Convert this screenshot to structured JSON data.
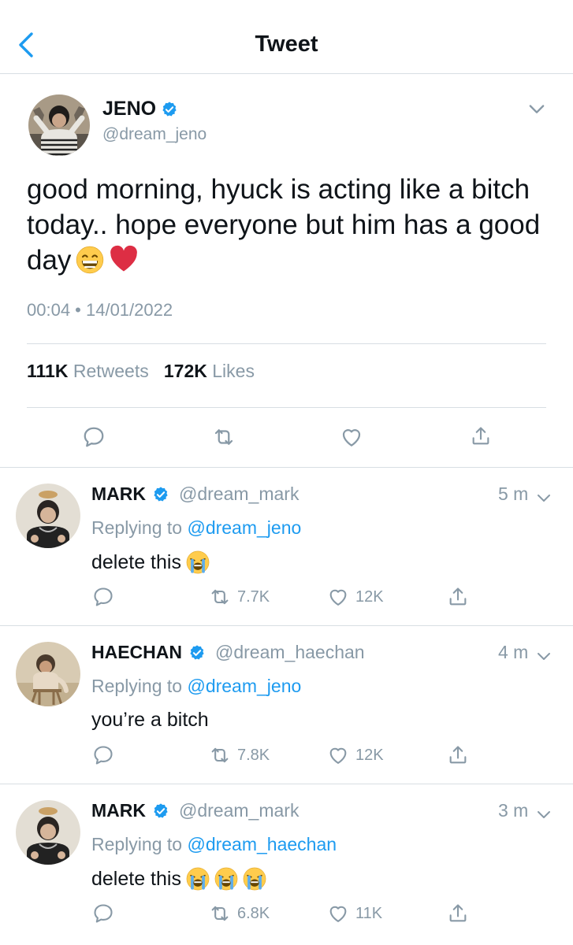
{
  "header": {
    "title": "Tweet",
    "back_icon": "chevron-left-icon"
  },
  "colors": {
    "accent": "#1d9bf0",
    "verified": "#1d9bf0",
    "muted": "#8899a6",
    "text": "#0f1419",
    "heart": "#e0245e"
  },
  "tweet": {
    "name": "JENO",
    "handle": "@dream_jeno",
    "text": "good morning, hyuck is acting like a bitch today.. hope everyone but him has a good day",
    "emojis": [
      "grinning-face-emoji",
      "red-heart-emoji"
    ],
    "timestamp": "00:04 • 14/01/2022",
    "retweets_count": "111K",
    "retweets_label": "Retweets",
    "likes_count": "172K",
    "likes_label": "Likes"
  },
  "replies": [
    {
      "name": "MARK",
      "handle": "@dream_mark",
      "time": "5 m",
      "replying_prefix": "Replying to",
      "replying_to": "@dream_jeno",
      "text": "delete this",
      "emoji_count": 1,
      "retweets": "7.7K",
      "likes": "12K"
    },
    {
      "name": "HAECHAN",
      "handle": "@dream_haechan",
      "time": "4 m",
      "replying_prefix": "Replying to",
      "replying_to": "@dream_jeno",
      "text": "you’re a bitch",
      "emoji_count": 0,
      "retweets": "7.8K",
      "likes": "12K"
    },
    {
      "name": "MARK",
      "handle": "@dream_mark",
      "time": "3 m",
      "replying_prefix": "Replying to",
      "replying_to": "@dream_haechan",
      "text": "delete this",
      "emoji_count": 3,
      "retweets": "6.8K",
      "likes": "11K"
    }
  ]
}
